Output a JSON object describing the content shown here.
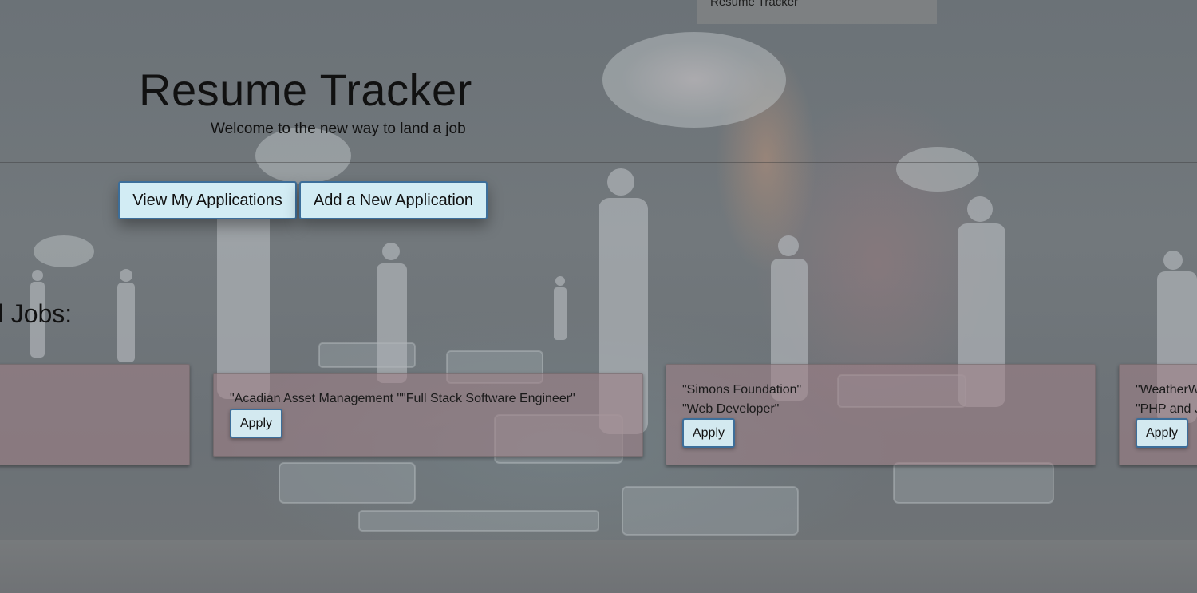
{
  "nav": {
    "tab_label": "Resume Tracker"
  },
  "header": {
    "title": "Resume Tracker",
    "subtitle": "Welcome to the new way to land a job"
  },
  "actions": {
    "view_applications": "View My Applications",
    "add_application": "Add a New Application"
  },
  "jobs": {
    "heading": "d Jobs:",
    "cards": [
      {
        "company": "",
        "position": "",
        "apply_label": ""
      },
      {
        "line": "\"Acadian Asset Management \"\"Full Stack Software Engineer\"",
        "apply_label": "Apply"
      },
      {
        "company": "\"Simons Foundation\"",
        "position": "\"Web Developer\"",
        "apply_label": "Apply"
      },
      {
        "company": "\"WeatherW",
        "position": "\"PHP and J",
        "apply_label": "Apply"
      }
    ]
  },
  "colors": {
    "button_bg": "#d2ecf4",
    "button_border": "#3c6e9a",
    "card_bg": "#9e8087"
  }
}
